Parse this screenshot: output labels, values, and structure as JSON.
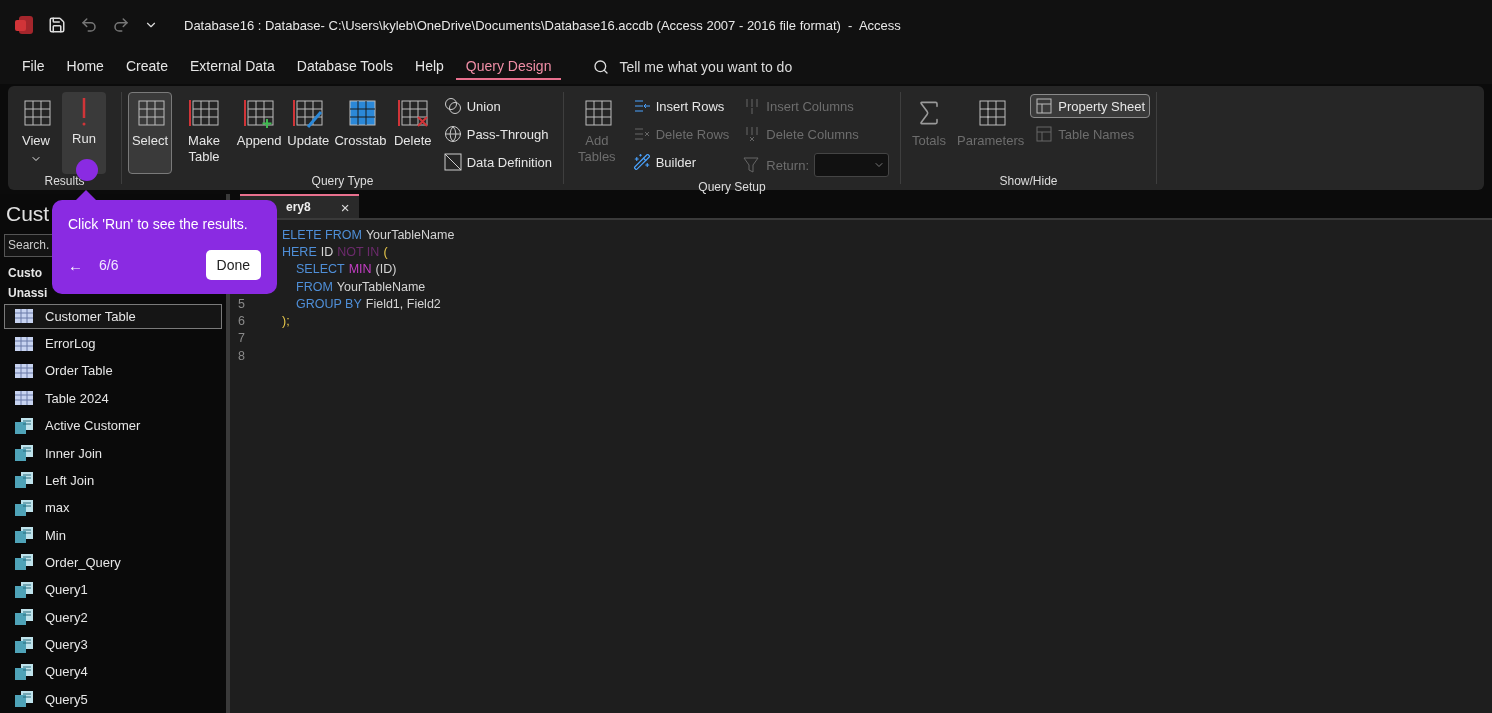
{
  "title_bar": {
    "title": "Database16 : Database- C:\\Users\\kyleb\\OneDrive\\Documents\\Database16.accdb (Access 2007 - 2016 file format)  -  Access"
  },
  "menu_tabs": [
    {
      "label": "File",
      "selected": false
    },
    {
      "label": "Home",
      "selected": false
    },
    {
      "label": "Create",
      "selected": false
    },
    {
      "label": "External Data",
      "selected": false
    },
    {
      "label": "Database Tools",
      "selected": false
    },
    {
      "label": "Help",
      "selected": false
    },
    {
      "label": "Query Design",
      "selected": true
    }
  ],
  "tell_me": {
    "placeholder": "Tell me what you want to do"
  },
  "ribbon": [
    {
      "label": "Results",
      "items": [
        {
          "kind": "large",
          "label": "View",
          "dropdown": true,
          "disabled": false,
          "selected": false
        },
        {
          "kind": "large",
          "label": "Run",
          "disabled": false,
          "selected": true
        }
      ]
    },
    {
      "label": "Query Type",
      "items": [
        {
          "kind": "large",
          "label": "Select",
          "disabled": false,
          "selected": true
        },
        {
          "kind": "large",
          "label": "Make Table",
          "disabled": false,
          "selected": false
        },
        {
          "kind": "large",
          "label": "Append",
          "disabled": false,
          "selected": false
        },
        {
          "kind": "large",
          "label": "Update",
          "disabled": false,
          "selected": false
        },
        {
          "kind": "large",
          "label": "Crosstab",
          "disabled": false,
          "selected": false
        },
        {
          "kind": "large",
          "label": "Delete",
          "disabled": false,
          "selected": false
        },
        {
          "kind": "small",
          "label": "Union",
          "disabled": false,
          "selected": false
        },
        {
          "kind": "small",
          "label": "Pass-Through",
          "disabled": false,
          "selected": false
        },
        {
          "kind": "small",
          "label": "Data Definition",
          "disabled": false,
          "selected": false
        }
      ]
    },
    {
      "label": "Query Setup",
      "items": [
        {
          "kind": "large",
          "label": "Add Tables",
          "disabled": true,
          "selected": false
        },
        {
          "kind": "small",
          "label": "Insert Rows",
          "disabled": false,
          "selected": false
        },
        {
          "kind": "small",
          "label": "Delete Rows",
          "disabled": true,
          "selected": false
        },
        {
          "kind": "small",
          "label": "Builder",
          "disabled": false,
          "selected": false
        },
        {
          "kind": "small",
          "label": "Insert Columns",
          "disabled": true,
          "selected": false
        },
        {
          "kind": "small",
          "label": "Delete Columns",
          "disabled": true,
          "selected": false
        },
        {
          "kind": "combo",
          "label": "Return:",
          "disabled": true
        }
      ]
    },
    {
      "label": "Show/Hide",
      "items": [
        {
          "kind": "large",
          "label": "Totals",
          "disabled": true,
          "selected": false
        },
        {
          "kind": "large",
          "label": "Parameters",
          "disabled": true,
          "selected": false
        },
        {
          "kind": "small",
          "label": "Property Sheet",
          "disabled": false,
          "selected": true
        },
        {
          "kind": "small",
          "label": "Table Names",
          "disabled": true,
          "selected": false
        }
      ]
    }
  ],
  "nav_pane": {
    "heading": "Cust",
    "search": {
      "placeholder": "Search."
    },
    "groups": [
      "Custo",
      "Unassi"
    ],
    "items": [
      {
        "kind": "table",
        "label": "Customer Table",
        "selected": true
      },
      {
        "kind": "table",
        "label": "ErrorLog",
        "selected": false
      },
      {
        "kind": "table",
        "label": "Order Table",
        "selected": false
      },
      {
        "kind": "table",
        "label": "Table 2024",
        "selected": false
      },
      {
        "kind": "query",
        "label": "Active Customer",
        "selected": false
      },
      {
        "kind": "query",
        "label": "Inner Join",
        "selected": false
      },
      {
        "kind": "query",
        "label": "Left Join",
        "selected": false
      },
      {
        "kind": "query",
        "label": "max",
        "selected": false
      },
      {
        "kind": "query",
        "label": "Min",
        "selected": false
      },
      {
        "kind": "query",
        "label": "Order_Query",
        "selected": false
      },
      {
        "kind": "query",
        "label": "Query1",
        "selected": false
      },
      {
        "kind": "query",
        "label": "Query2",
        "selected": false
      },
      {
        "kind": "query",
        "label": "Query3",
        "selected": false
      },
      {
        "kind": "query",
        "label": "Query4",
        "selected": false
      },
      {
        "kind": "query",
        "label": "Query5",
        "selected": false
      }
    ]
  },
  "document_tab": {
    "label": "ery8",
    "close": "×"
  },
  "editor": {
    "lines": [
      {
        "indent": false,
        "tokens": [
          {
            "kind": "keyword",
            "text": "ELETE FROM"
          },
          {
            "kind": "ident",
            "text": "YourTableName"
          }
        ]
      },
      {
        "indent": false,
        "tokens": [
          {
            "kind": "keyword",
            "text": "HERE"
          },
          {
            "kind": "ident",
            "text": "ID"
          },
          {
            "kind": "operator",
            "text": "NOT IN"
          },
          {
            "kind": "paren",
            "text": "("
          }
        ]
      },
      {
        "indent": true,
        "tokens": [
          {
            "kind": "keyword",
            "text": "SELECT"
          },
          {
            "kind": "function",
            "text": "MIN"
          },
          {
            "kind": "ident",
            "text": "(ID)"
          }
        ]
      },
      {
        "indent": true,
        "tokens": [
          {
            "kind": "keyword",
            "text": "FROM"
          },
          {
            "kind": "ident",
            "text": "YourTableName"
          }
        ]
      },
      {
        "number": "5",
        "indent": true,
        "tokens": [
          {
            "kind": "keyword",
            "text": "GROUP BY"
          },
          {
            "kind": "ident",
            "text": "Field1, Field2"
          }
        ]
      },
      {
        "number": "6",
        "indent": false,
        "tokens": [
          {
            "kind": "paren",
            "text": ");"
          }
        ]
      },
      {
        "number": "7"
      },
      {
        "number": "8"
      }
    ]
  },
  "tour_tooltip": {
    "text": "Click 'Run' to see the results.",
    "back": "←",
    "step": "6/6",
    "done": "Done"
  }
}
